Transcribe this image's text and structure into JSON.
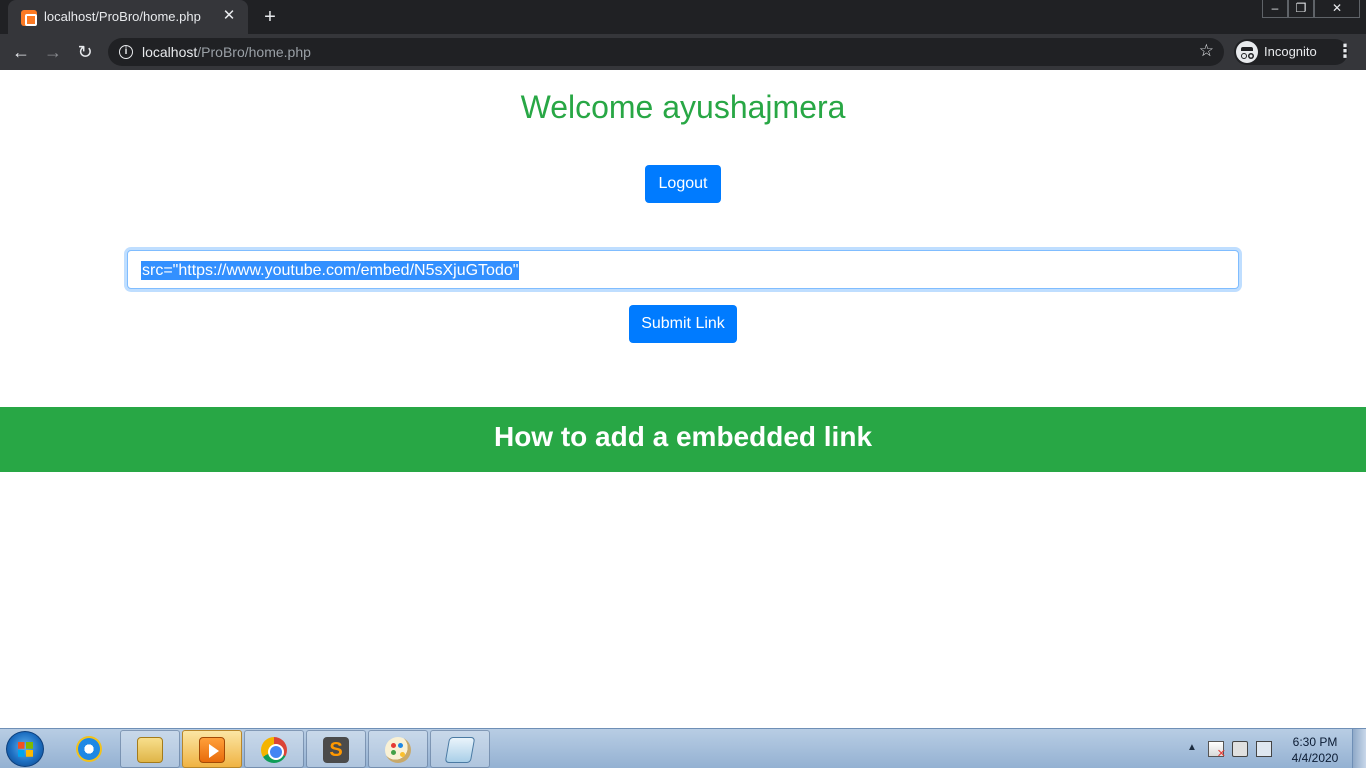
{
  "browser": {
    "tab_title": "localhost/ProBro/home.php",
    "tab_close": "✕",
    "new_tab": "+",
    "url_host": "localhost",
    "url_path": "/ProBro/home.php",
    "incognito_label": "Incognito",
    "window_controls": {
      "minimize": "–",
      "maximize": "❐",
      "close": "✕"
    }
  },
  "page": {
    "welcome": "Welcome ayushajmera",
    "logout_label": "Logout",
    "link_value": "src=\"https://www.youtube.com/embed/N5sXjuGTodo\"",
    "submit_label": "Submit Link",
    "banner_text": "How to add a embedded link",
    "accent_color": "#28a745",
    "button_color": "#007bff"
  },
  "taskbar": {
    "items": [
      "internet-explorer",
      "file-explorer",
      "media-player",
      "chrome",
      "sublime-text",
      "paint",
      "notepad"
    ],
    "clock_time": "6:30 PM",
    "clock_date": "4/4/2020"
  }
}
